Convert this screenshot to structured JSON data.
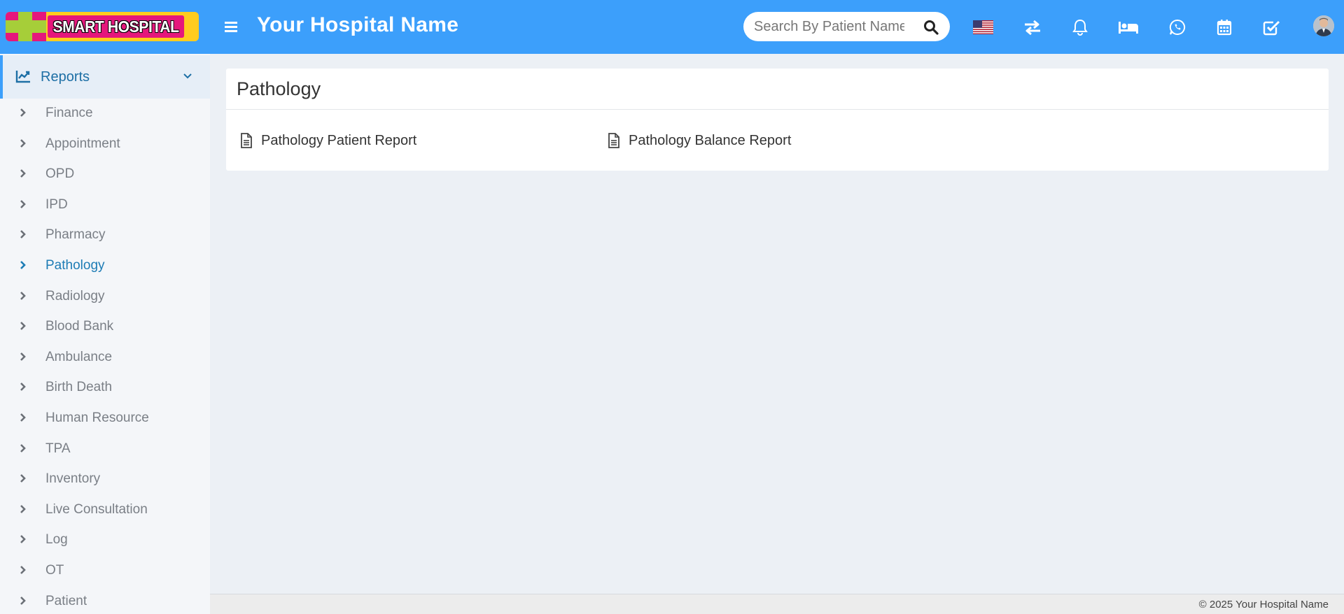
{
  "header": {
    "logo_text": "SMART HOSPITAL",
    "hospital_name": "Your Hospital Name",
    "search_placeholder": "Search By Patient Name",
    "icons": [
      "menu-icon",
      "search-icon",
      "us-flag-icon",
      "switch-icon",
      "bell-icon",
      "bed-icon",
      "whatsapp-icon",
      "calendar-icon",
      "checkbox-icon",
      "avatar"
    ],
    "brand_color": "#3c9ffb"
  },
  "sidebar": {
    "section": {
      "label": "Reports",
      "icon": "line-chart-icon"
    },
    "items": [
      {
        "label": "Finance"
      },
      {
        "label": "Appointment"
      },
      {
        "label": "OPD"
      },
      {
        "label": "IPD"
      },
      {
        "label": "Pharmacy"
      },
      {
        "label": "Pathology",
        "selected": true
      },
      {
        "label": "Radiology"
      },
      {
        "label": "Blood Bank"
      },
      {
        "label": "Ambulance"
      },
      {
        "label": "Birth Death"
      },
      {
        "label": "Human Resource"
      },
      {
        "label": "TPA"
      },
      {
        "label": "Inventory"
      },
      {
        "label": "Live Consultation"
      },
      {
        "label": "Log"
      },
      {
        "label": "OT"
      },
      {
        "label": "Patient"
      }
    ]
  },
  "main": {
    "title": "Pathology",
    "reports": [
      {
        "label": "Pathology Patient Report",
        "icon": "document-icon"
      },
      {
        "label": "Pathology Balance Report",
        "icon": "document-icon"
      }
    ]
  },
  "footer": {
    "text": "© 2025 Your Hospital Name"
  }
}
